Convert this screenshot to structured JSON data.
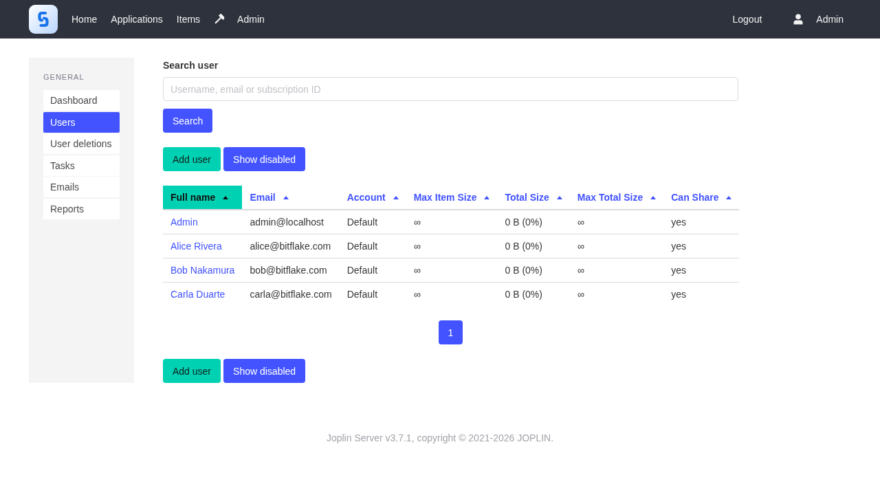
{
  "navbar": {
    "links": [
      {
        "label": "Home",
        "kind": "text"
      },
      {
        "label": "Applications",
        "kind": "text"
      },
      {
        "label": "Items",
        "kind": "text"
      },
      {
        "label": "Admin",
        "kind": "tool"
      }
    ],
    "logout": "Logout",
    "user": "Admin"
  },
  "sidebar": {
    "section_title": "GENERAL",
    "items": [
      {
        "label": "Dashboard",
        "selected": false
      },
      {
        "label": "Users",
        "selected": true
      },
      {
        "label": "User deletions",
        "selected": false
      },
      {
        "label": "Tasks",
        "selected": false
      },
      {
        "label": "Emails",
        "selected": false
      },
      {
        "label": "Reports",
        "selected": false
      }
    ]
  },
  "search": {
    "label": "Search user",
    "placeholder": "Username, email or subscription ID",
    "button": "Search"
  },
  "actions_top": [
    {
      "label": "Add user",
      "kind": "accent"
    },
    {
      "label": "Show disabled",
      "kind": "primary"
    }
  ],
  "table": {
    "columns": [
      {
        "label": "Full name",
        "selected": true,
        "kind": "link"
      },
      {
        "label": "Email",
        "selected": false,
        "kind": "text"
      },
      {
        "label": "Account",
        "selected": false,
        "kind": "text"
      },
      {
        "label": "Max Item Size",
        "selected": false,
        "kind": "text"
      },
      {
        "label": "Total Size",
        "selected": false,
        "kind": "text"
      },
      {
        "label": "Max Total Size",
        "selected": false,
        "kind": "text"
      },
      {
        "label": "Can Share",
        "selected": false,
        "kind": "text"
      }
    ],
    "rows": [
      {
        "cells": [
          "Admin",
          "admin@localhost",
          "Default",
          "∞",
          "0 B (0%)",
          "∞",
          "yes"
        ]
      },
      {
        "cells": [
          "Alice Rivera",
          "alice@bitflake.com",
          "Default",
          "∞",
          "0 B (0%)",
          "∞",
          "yes"
        ]
      },
      {
        "cells": [
          "Bob Nakamura",
          "bob@bitflake.com",
          "Default",
          "∞",
          "0 B (0%)",
          "∞",
          "yes"
        ]
      },
      {
        "cells": [
          "Carla Duarte",
          "carla@bitflake.com",
          "Default",
          "∞",
          "0 B (0%)",
          "∞",
          "yes"
        ]
      }
    ]
  },
  "pagination": [
    {
      "label": "1",
      "selected": true
    }
  ],
  "actions_bottom": [
    {
      "label": "Add user",
      "kind": "accent"
    },
    {
      "label": "Show disabled",
      "kind": "primary"
    }
  ],
  "footer": "Joplin Server v3.7.1, copyright © 2021-2026 JOPLIN."
}
